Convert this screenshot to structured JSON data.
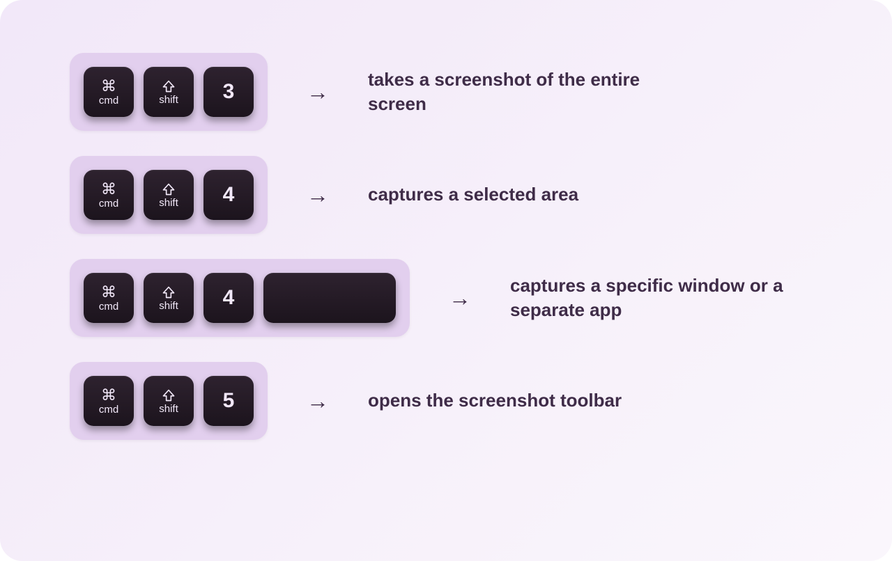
{
  "shortcuts": [
    {
      "keys": [
        {
          "type": "cmd",
          "icon": "⌘",
          "label": "cmd"
        },
        {
          "type": "shift",
          "icon": "shift-arrow",
          "label": "shift"
        },
        {
          "type": "num",
          "main": "3"
        }
      ],
      "arrow": "→",
      "description": "takes a screenshot of the entire screen"
    },
    {
      "keys": [
        {
          "type": "cmd",
          "icon": "⌘",
          "label": "cmd"
        },
        {
          "type": "shift",
          "icon": "shift-arrow",
          "label": "shift"
        },
        {
          "type": "num",
          "main": "4"
        }
      ],
      "arrow": "→",
      "description": "captures a selected area"
    },
    {
      "keys": [
        {
          "type": "cmd",
          "icon": "⌘",
          "label": "cmd"
        },
        {
          "type": "shift",
          "icon": "shift-arrow",
          "label": "shift"
        },
        {
          "type": "num",
          "main": "4"
        },
        {
          "type": "space"
        }
      ],
      "arrow": "→",
      "description": "captures a specific window or a separate app"
    },
    {
      "keys": [
        {
          "type": "cmd",
          "icon": "⌘",
          "label": "cmd"
        },
        {
          "type": "shift",
          "icon": "shift-arrow",
          "label": "shift"
        },
        {
          "type": "num",
          "main": "5"
        }
      ],
      "arrow": "→",
      "description": "opens the screenshot toolbar"
    }
  ]
}
